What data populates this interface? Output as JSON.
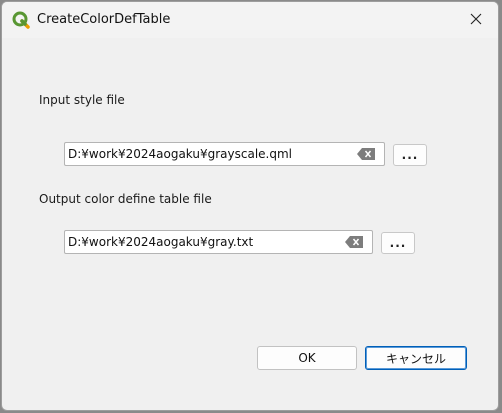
{
  "window": {
    "title": "CreateColorDefTable",
    "accent": "#005fb8"
  },
  "input_style": {
    "label": "Input style file",
    "value": "D:¥work¥2024aogaku¥grayscale.qml",
    "browse_label": "..."
  },
  "output_table": {
    "label": "Output color define table file",
    "value": "D:¥work¥2024aogaku¥gray.txt",
    "browse_label": "..."
  },
  "buttons": {
    "ok": "OK",
    "cancel": "キャンセル"
  },
  "icons": {
    "app": "qgis-logo-icon",
    "close": "close-icon",
    "clear": "clear-text-icon"
  }
}
